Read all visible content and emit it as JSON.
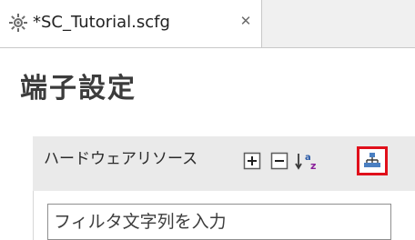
{
  "tab": {
    "title": "*SC_Tutorial.scfg",
    "icon": "gear-icon",
    "close_icon": "close-icon"
  },
  "editor": {
    "title": "端子設定"
  },
  "section": {
    "title": "ハードウェアリソース",
    "toolbar": [
      "expand-all-icon",
      "collapse-all-icon",
      "sort-az-icon",
      "hierarchy-icon"
    ],
    "highlight_color": "#e0101b"
  },
  "filter": {
    "placeholder": "フィルタ文字列を入力"
  }
}
